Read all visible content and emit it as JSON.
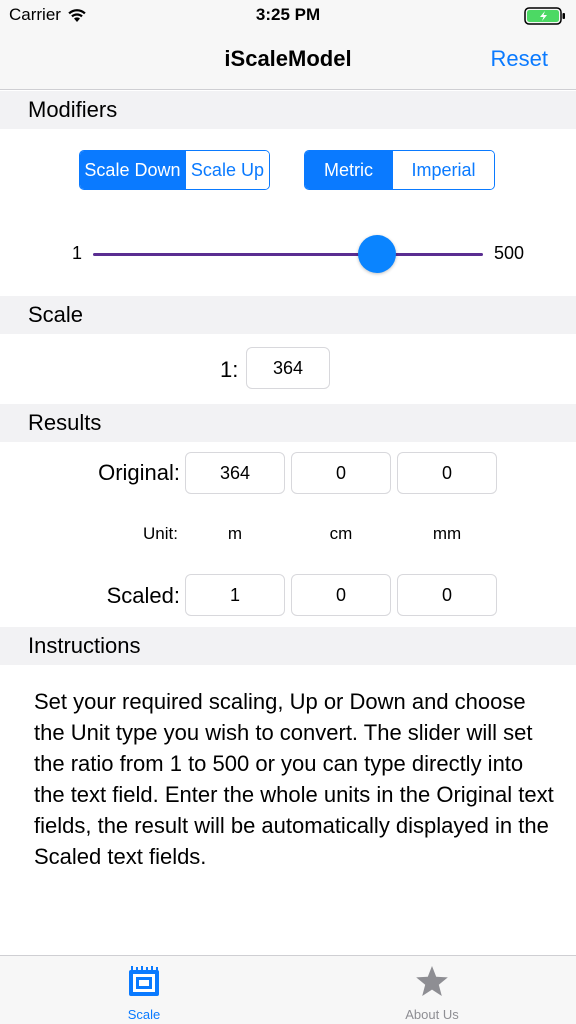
{
  "status_bar": {
    "carrier": "Carrier",
    "time": "3:25 PM"
  },
  "nav": {
    "title": "iScaleModel",
    "reset_label": "Reset"
  },
  "sections": {
    "modifiers": "Modifiers",
    "scale": "Scale",
    "results": "Results",
    "instructions": "Instructions"
  },
  "modifiers": {
    "direction": {
      "options": [
        "Scale Down",
        "Scale Up"
      ],
      "selected": "Scale Down"
    },
    "units": {
      "options": [
        "Metric",
        "Imperial"
      ],
      "selected": "Metric"
    },
    "slider": {
      "min_label": "1",
      "max_label": "500",
      "min": 1,
      "max": 500,
      "value": 364
    }
  },
  "scale": {
    "prefix": "1:",
    "value": "364"
  },
  "results": {
    "original_label": "Original:",
    "scaled_label": "Scaled:",
    "unit_label": "Unit:",
    "units": [
      "m",
      "cm",
      "mm"
    ],
    "original": [
      "364",
      "0",
      "0"
    ],
    "scaled": [
      "1",
      "0",
      "0"
    ]
  },
  "instructions": {
    "text": "Set your required scaling, Up or Down and choose the Unit type you wish to convert. The slider will set the ratio from 1 to 500 or you can type directly into the text field. Enter the whole units in the Original text fields, the result will be automatically displayed in the Scaled text fields."
  },
  "tab_bar": {
    "tabs": [
      {
        "label": "Scale",
        "icon": "scale-ruler-icon",
        "selected": true
      },
      {
        "label": "About Us",
        "icon": "star-icon",
        "selected": false
      }
    ]
  },
  "colors": {
    "accent": "#0a7aff",
    "slider_track": "#5a2d91",
    "inactive": "#8e8e93"
  }
}
